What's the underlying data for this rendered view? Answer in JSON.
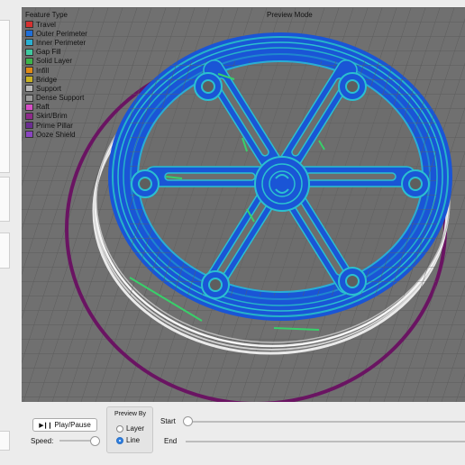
{
  "viewport": {
    "mode_label": "Preview Mode"
  },
  "legend": {
    "title": "Feature Type",
    "items": [
      {
        "label": "Travel",
        "color": "#d53030"
      },
      {
        "label": "Outer Perimeter",
        "color": "#1f6fd9"
      },
      {
        "label": "Inner Perimeter",
        "color": "#2ab0d2"
      },
      {
        "label": "Gap Fill",
        "color": "#40c9a0"
      },
      {
        "label": "Solid Layer",
        "color": "#3cb44b"
      },
      {
        "label": "Infill",
        "color": "#e08a16"
      },
      {
        "label": "Bridge",
        "color": "#c8b224"
      },
      {
        "label": "Support",
        "color": "#b8b8b8"
      },
      {
        "label": "Dense Support",
        "color": "#9a9a9a"
      },
      {
        "label": "Raft",
        "color": "#d64fc6"
      },
      {
        "label": "Skirt/Brim",
        "color": "#8e2a8a"
      },
      {
        "label": "Prime Pillar",
        "color": "#6a2c90"
      },
      {
        "label": "Ooze Shield",
        "color": "#8a44c0"
      }
    ]
  },
  "controls": {
    "play_label": "Play/Pause",
    "speed_label": "Speed:",
    "preview_by_title": "Preview By",
    "preview_options": [
      {
        "label": "Layer",
        "selected": false
      },
      {
        "label": "Line",
        "selected": true
      }
    ],
    "start_label": "Start",
    "end_label": "End"
  }
}
